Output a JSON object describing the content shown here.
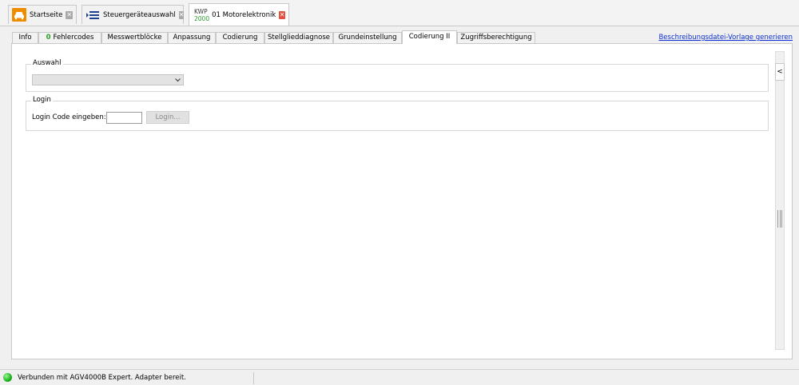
{
  "doc_tabs": [
    {
      "label": "Startseite",
      "icon": "car-icon",
      "close": "✕"
    },
    {
      "label": "Steuergeräteauswahl",
      "icon": "ecu-list-icon",
      "close": "✕"
    },
    {
      "protocol_top": "KWP",
      "protocol_bottom": "2000",
      "label": "01 Motorelektronik",
      "close": "✕",
      "active": true
    }
  ],
  "sub_tabs": [
    {
      "label": "Info"
    },
    {
      "badge": "0",
      "label": "Fehlercodes"
    },
    {
      "label": "Messwertblöcke"
    },
    {
      "label": "Anpassung"
    },
    {
      "label": "Codierung"
    },
    {
      "label": "Stellglieddiagnose"
    },
    {
      "label": "Grundeinstellung"
    },
    {
      "label": "Codierung II",
      "active": true
    },
    {
      "label": "Zugriffsberechtigung"
    }
  ],
  "top_link": "Beschreibungsdatei-Vorlage generieren",
  "auswahl": {
    "legend": "Auswahl",
    "value": ""
  },
  "login": {
    "legend": "Login",
    "label": "Login Code eingeben:",
    "input_value": "",
    "button": "Login..."
  },
  "scrollbar": {
    "collapse": "<"
  },
  "status": {
    "text": "Verbunden mit AGV4000B Expert. Adapter bereit.",
    "color": "#19b319"
  },
  "colors": {
    "accent_orange": "#f08c00",
    "link": "#0b2ed6",
    "close_active": "#e2523e",
    "badge_green": "#28a028"
  }
}
